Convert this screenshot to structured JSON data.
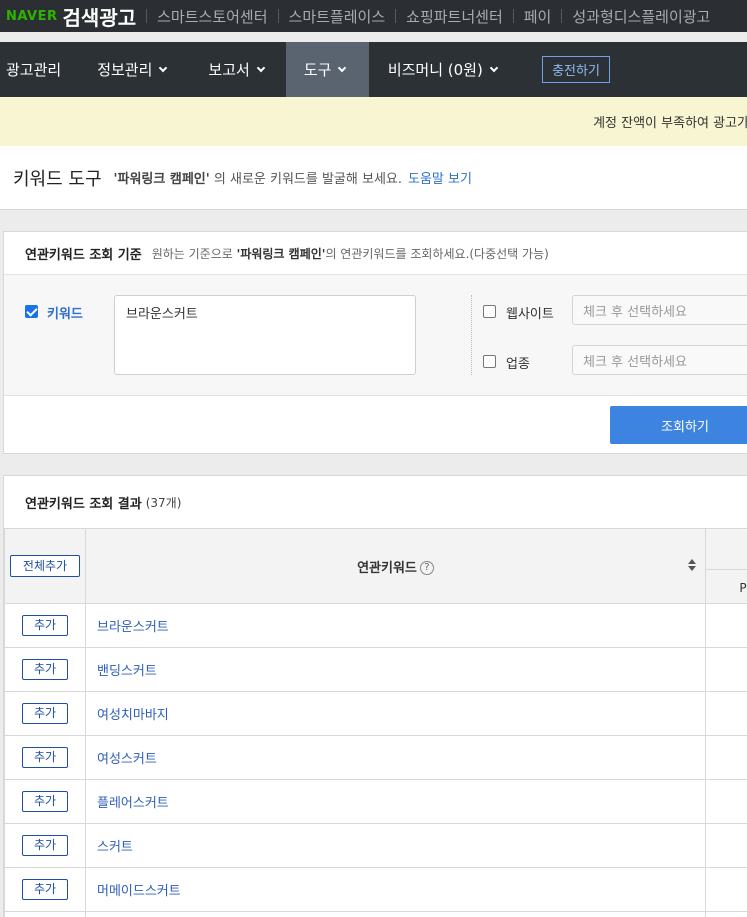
{
  "topbar": {
    "brand_naver": "NAVER",
    "brand_service": "검색광고",
    "links": [
      "스마트스토어센터",
      "스마트플레이스",
      "쇼핑파트너센터",
      "페이",
      "성과형디스플레이광고"
    ]
  },
  "nav": {
    "items": [
      {
        "label": "광고관리",
        "has_caret": false
      },
      {
        "label": "정보관리",
        "has_caret": true
      },
      {
        "label": "보고서",
        "has_caret": true
      },
      {
        "label": "도구",
        "has_caret": true,
        "active": true
      },
      {
        "label": "비즈머니 (0원)",
        "has_caret": true
      }
    ],
    "charge_label": "충전하기"
  },
  "notice": {
    "text": "계정 잔액이 부족하여 광고가"
  },
  "page": {
    "title": "키워드 도구",
    "campaign": "'파워링크 캠페인'",
    "desc_suffix": "의 새로운 키워드를 발굴해 보세요.",
    "help_link": "도움말 보기"
  },
  "criteria": {
    "title": "연관키워드 조회 기준",
    "desc_prefix": "원하는 기준으로",
    "desc_campaign": "'파워링크 캠페인'",
    "desc_suffix": "의 연관키워드를 조회하세요.(다중선택 가능)",
    "keyword_label": "키워드",
    "keyword_checked": true,
    "keyword_value": "브라운스커트",
    "website_label": "웹사이트",
    "website_checked": false,
    "website_placeholder": "체크 후 선택하세요",
    "industry_label": "업종",
    "industry_checked": false,
    "industry_placeholder": "체크 후 선택하세요",
    "search_button": "조회하기"
  },
  "results": {
    "title": "연관키워드 조회 결과",
    "count": "(37개)",
    "add_all_label": "전체추가",
    "keyword_col_header": "연관키워드",
    "help_icon": "?",
    "rest_sub_header": "P",
    "add_label": "추가",
    "rows": [
      "브라운스커트",
      "밴딩스커트",
      "여성치마바지",
      "여성스커트",
      "플레어스커트",
      "스커트",
      "머메이드스커트",
      ""
    ]
  },
  "colors": {
    "topbar_bg": "#2b2e32",
    "nav_bg": "#2c3136",
    "nav_active": "#5a6370",
    "naver_green": "#2db400",
    "accent_blue": "#3d84e0",
    "link_blue": "#2e6fcf",
    "notice_bg": "#f8f6d2"
  }
}
